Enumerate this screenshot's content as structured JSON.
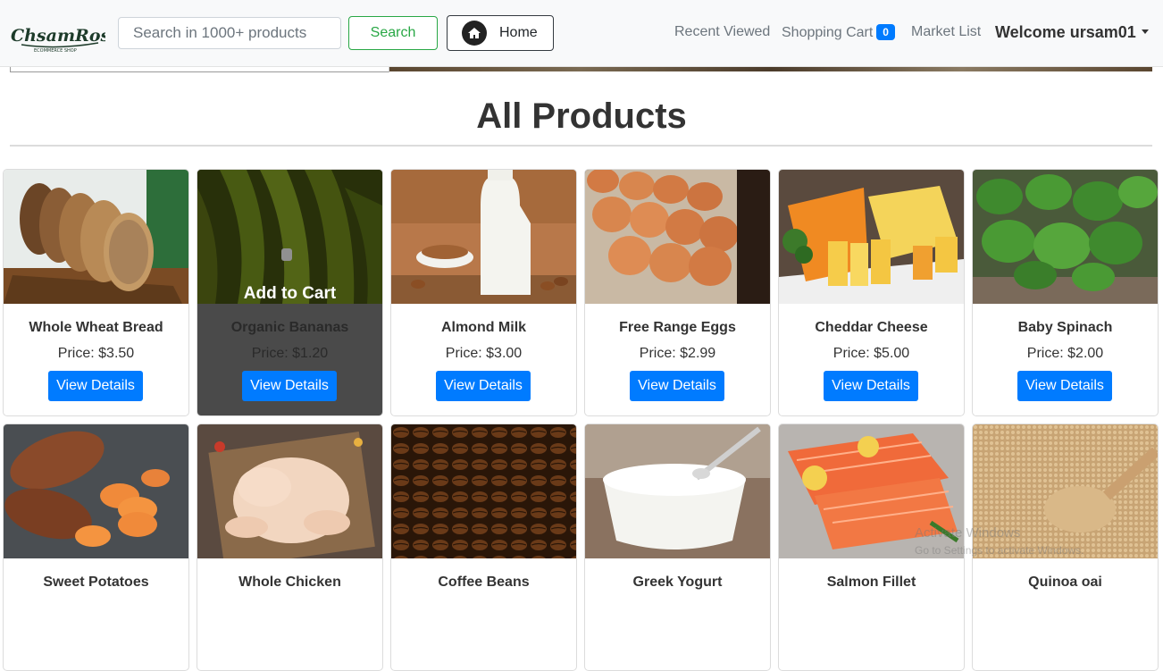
{
  "navbar": {
    "logo_text": "ChsamRosko",
    "logo_sub": "ECOMMERCE SHOP",
    "search_placeholder": "Search in 1000+ products",
    "search_button": "Search",
    "home_button": "Home",
    "links": {
      "recent": "Recent Viewed",
      "cart": "Shopping Cart",
      "cart_count": "0",
      "market": "Market List"
    },
    "welcome": "Welcome ursam01"
  },
  "page": {
    "title": "All Products"
  },
  "hover_overlay": "Add to Cart",
  "products": [
    {
      "name": "Whole Wheat Bread",
      "price": "Price: $3.50",
      "button": "View Details",
      "image": "bread-image"
    },
    {
      "name": "Organic Bananas",
      "price": "Price: $1.20",
      "button": "View Details",
      "image": "bananas-image"
    },
    {
      "name": "Almond Milk",
      "price": "Price: $3.00",
      "button": "View Details",
      "image": "almond-milk-image"
    },
    {
      "name": "Free Range Eggs",
      "price": "Price: $2.99",
      "button": "View Details",
      "image": "eggs-image"
    },
    {
      "name": "Cheddar Cheese",
      "price": "Price: $5.00",
      "button": "View Details",
      "image": "cheese-image"
    },
    {
      "name": "Baby Spinach",
      "price": "Price: $2.00",
      "button": "View Details",
      "image": "spinach-image"
    },
    {
      "name": "Sweet Potatoes",
      "image": "sweet-potatoes-image"
    },
    {
      "name": "Whole Chicken",
      "image": "chicken-image"
    },
    {
      "name": "Coffee Beans",
      "image": "coffee-beans-image"
    },
    {
      "name": "Greek Yogurt",
      "image": "yogurt-image"
    },
    {
      "name": "Salmon Fillet",
      "image": "salmon-image"
    },
    {
      "name": "Quinoa oai",
      "image": "quinoa-image"
    }
  ],
  "watermark": {
    "line1": "Activate Windows",
    "line2": "Go to Settings to activate Windows."
  },
  "colors": {
    "primary": "#007bff",
    "success": "#28a745",
    "navbar_bg": "#f8f9fa"
  }
}
